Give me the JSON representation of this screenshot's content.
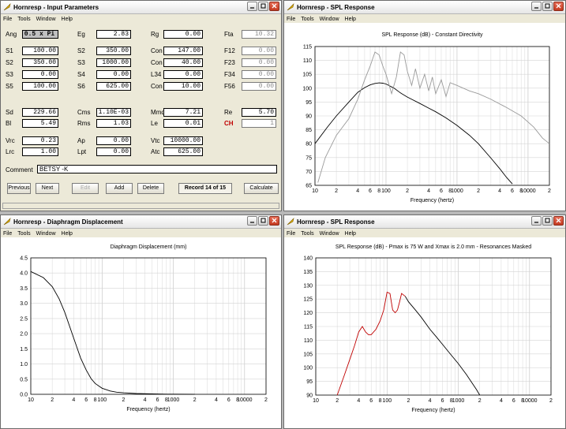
{
  "app": "Hornresp",
  "menu": [
    "File",
    "Tools",
    "Window",
    "Help"
  ],
  "windows": {
    "input": {
      "title": "Hornresp - Input Parameters"
    },
    "spl_cd": {
      "title": "Hornresp - SPL Response"
    },
    "disp": {
      "title": "Hornresp - Diaphragm Displacement"
    },
    "spl": {
      "title": "Hornresp - SPL Response"
    }
  },
  "params": {
    "rows1": [
      [
        {
          "l": "Ang",
          "v": "0.5 x Pi",
          "dark": true
        },
        {
          "l": "Eg",
          "v": "2.83"
        },
        {
          "l": "Rg",
          "v": "0.00"
        },
        {
          "l": "Fta",
          "v": "10.32",
          "gray": true
        }
      ]
    ],
    "rows2": [
      [
        {
          "l": "S1",
          "v": "100.00"
        },
        {
          "l": "S2",
          "v": "350.00"
        },
        {
          "l": "Con",
          "v": "147.00"
        },
        {
          "l": "F12",
          "v": "0.00",
          "gray": true
        }
      ],
      [
        {
          "l": "S2",
          "v": "350.00"
        },
        {
          "l": "S3",
          "v": "1000.00"
        },
        {
          "l": "Con",
          "v": "40.00"
        },
        {
          "l": "F23",
          "v": "0.00",
          "gray": true
        }
      ],
      [
        {
          "l": "S3",
          "v": "0.00"
        },
        {
          "l": "S4",
          "v": "0.00"
        },
        {
          "l": "L34",
          "v": "0.00"
        },
        {
          "l": "F34",
          "v": "0.00",
          "gray": true
        }
      ],
      [
        {
          "l": "S5",
          "v": "100.00"
        },
        {
          "l": "S6",
          "v": "625.00"
        },
        {
          "l": "Con",
          "v": "10.00"
        },
        {
          "l": "F56",
          "v": "0.00",
          "gray": true
        }
      ]
    ],
    "rows3": [
      [
        {
          "l": "Sd",
          "v": "229.66"
        },
        {
          "l": "Cms",
          "v": "1.10E-03"
        },
        {
          "l": "Mmd",
          "v": "7.21"
        },
        {
          "l": "Re",
          "v": "5.70"
        }
      ],
      [
        {
          "l": "Bl",
          "v": "5.49"
        },
        {
          "l": "Rms",
          "v": "1.03"
        },
        {
          "l": "Le",
          "v": "0.01"
        },
        {
          "l": "CH",
          "v": "1",
          "gray": true,
          "red": true
        }
      ]
    ],
    "rows4": [
      [
        {
          "l": "Vrc",
          "v": "0.23"
        },
        {
          "l": "Ap",
          "v": "0.00"
        },
        {
          "l": "Vtc",
          "v": "10000.00"
        }
      ],
      [
        {
          "l": "Lrc",
          "v": "1.00"
        },
        {
          "l": "Lpt",
          "v": "0.00"
        },
        {
          "l": "Atc",
          "v": "625.00"
        }
      ]
    ],
    "comment_label": "Comment",
    "comment": "BETSY -K",
    "buttons": [
      "Previous",
      "Next",
      "Edit",
      "Add",
      "Delete"
    ],
    "record": "Record 14 of 15",
    "calculate": "Calculate"
  },
  "chart_data": [
    {
      "type": "line",
      "title": "SPL Response (dB) - Constant Directivity",
      "xlabel": "Frequency (hertz)",
      "ylabel": "",
      "xscale": "log",
      "xlim": [
        10,
        20000
      ],
      "ylim": [
        65,
        115
      ],
      "yticks": [
        65,
        70,
        75,
        80,
        85,
        90,
        95,
        100,
        105,
        110,
        115
      ],
      "grid": true,
      "series": [
        {
          "color": "#000000",
          "x": [
            10,
            15,
            20,
            30,
            40,
            50,
            60,
            70,
            80,
            90,
            100,
            130,
            160,
            200,
            300,
            400,
            500,
            700,
            1000,
            1500,
            2000,
            3000,
            4000,
            5000,
            6000
          ],
          "y": [
            80,
            86,
            90,
            95,
            98.5,
            100.2,
            101.2,
            101.7,
            101.9,
            101.8,
            101.5,
            100,
            98.3,
            96.8,
            94.5,
            92.8,
            91.5,
            89.3,
            86.6,
            83,
            80,
            74.8,
            71,
            67.8,
            65.5
          ]
        },
        {
          "color": "#9a9a9a",
          "x": [
            11,
            14,
            20,
            30,
            40,
            50,
            60,
            70,
            80,
            90,
            100,
            120,
            140,
            160,
            180,
            200,
            230,
            260,
            300,
            350,
            400,
            450,
            500,
            600,
            700,
            800,
            1000,
            1500,
            2000,
            3000,
            5000,
            8000,
            12000,
            16000,
            20000
          ],
          "y": [
            66,
            75,
            83,
            89,
            96,
            103,
            108,
            113,
            112,
            108,
            105,
            98,
            104,
            113,
            112,
            106,
            101,
            107,
            100,
            105,
            99,
            104,
            98,
            103,
            97,
            102,
            101,
            99,
            98,
            96,
            93,
            90,
            86,
            82,
            80
          ]
        }
      ]
    },
    {
      "type": "line",
      "title": "Diaphragm Displacement (mm)",
      "xlabel": "Frequency (hertz)",
      "ylabel": "",
      "xscale": "log",
      "xlim": [
        10,
        20000
      ],
      "ylim": [
        0,
        4.5
      ],
      "yticks": [
        0.0,
        0.5,
        1.0,
        1.5,
        2.0,
        2.5,
        3.0,
        3.5,
        4.0,
        4.5
      ],
      "grid": true,
      "series": [
        {
          "color": "#000000",
          "x": [
            10,
            15,
            20,
            25,
            30,
            40,
            50,
            60,
            70,
            80,
            100,
            130,
            160,
            200,
            300,
            500,
            800,
            1000,
            2000
          ],
          "y": [
            4.05,
            3.85,
            3.55,
            3.15,
            2.7,
            1.85,
            1.2,
            0.8,
            0.52,
            0.36,
            0.2,
            0.11,
            0.07,
            0.05,
            0.025,
            0.012,
            0.006,
            0.004,
            0.001
          ]
        }
      ]
    },
    {
      "type": "line",
      "title": "SPL Response (dB) - Pmax is 75 W and Xmax is 2.0 mm - Resonances Masked",
      "xlabel": "Frequency (hertz)",
      "ylabel": "",
      "xscale": "log",
      "xlim": [
        10,
        20000
      ],
      "ylim": [
        90,
        140
      ],
      "yticks": [
        90,
        95,
        100,
        105,
        110,
        115,
        120,
        125,
        130,
        135,
        140
      ],
      "grid": true,
      "series": [
        {
          "color": "#c00000",
          "x": [
            20,
            25,
            30,
            35,
            40,
            45,
            50,
            55,
            60,
            70,
            80,
            90,
            100,
            110,
            120,
            130,
            140,
            150,
            160,
            180
          ],
          "y": [
            90,
            97,
            103,
            108,
            113,
            115,
            113,
            112,
            112,
            114,
            117,
            121,
            127.5,
            127,
            121,
            120,
            121,
            124,
            127,
            126
          ]
        },
        {
          "color": "#000000",
          "x": [
            180,
            200,
            250,
            300,
            400,
            500,
            600,
            800,
            1000,
            1300,
            1600,
            1800,
            2000
          ],
          "y": [
            126,
            124,
            121,
            118.5,
            114,
            111,
            108.5,
            104.5,
            101.5,
            97.5,
            94,
            92,
            90
          ]
        }
      ]
    }
  ],
  "xticks": [
    "10",
    "2",
    "4",
    "6",
    "8",
    "100",
    "2",
    "4",
    "6",
    "8",
    "1000",
    "2",
    "4",
    "6",
    "8",
    "10000",
    "2"
  ]
}
